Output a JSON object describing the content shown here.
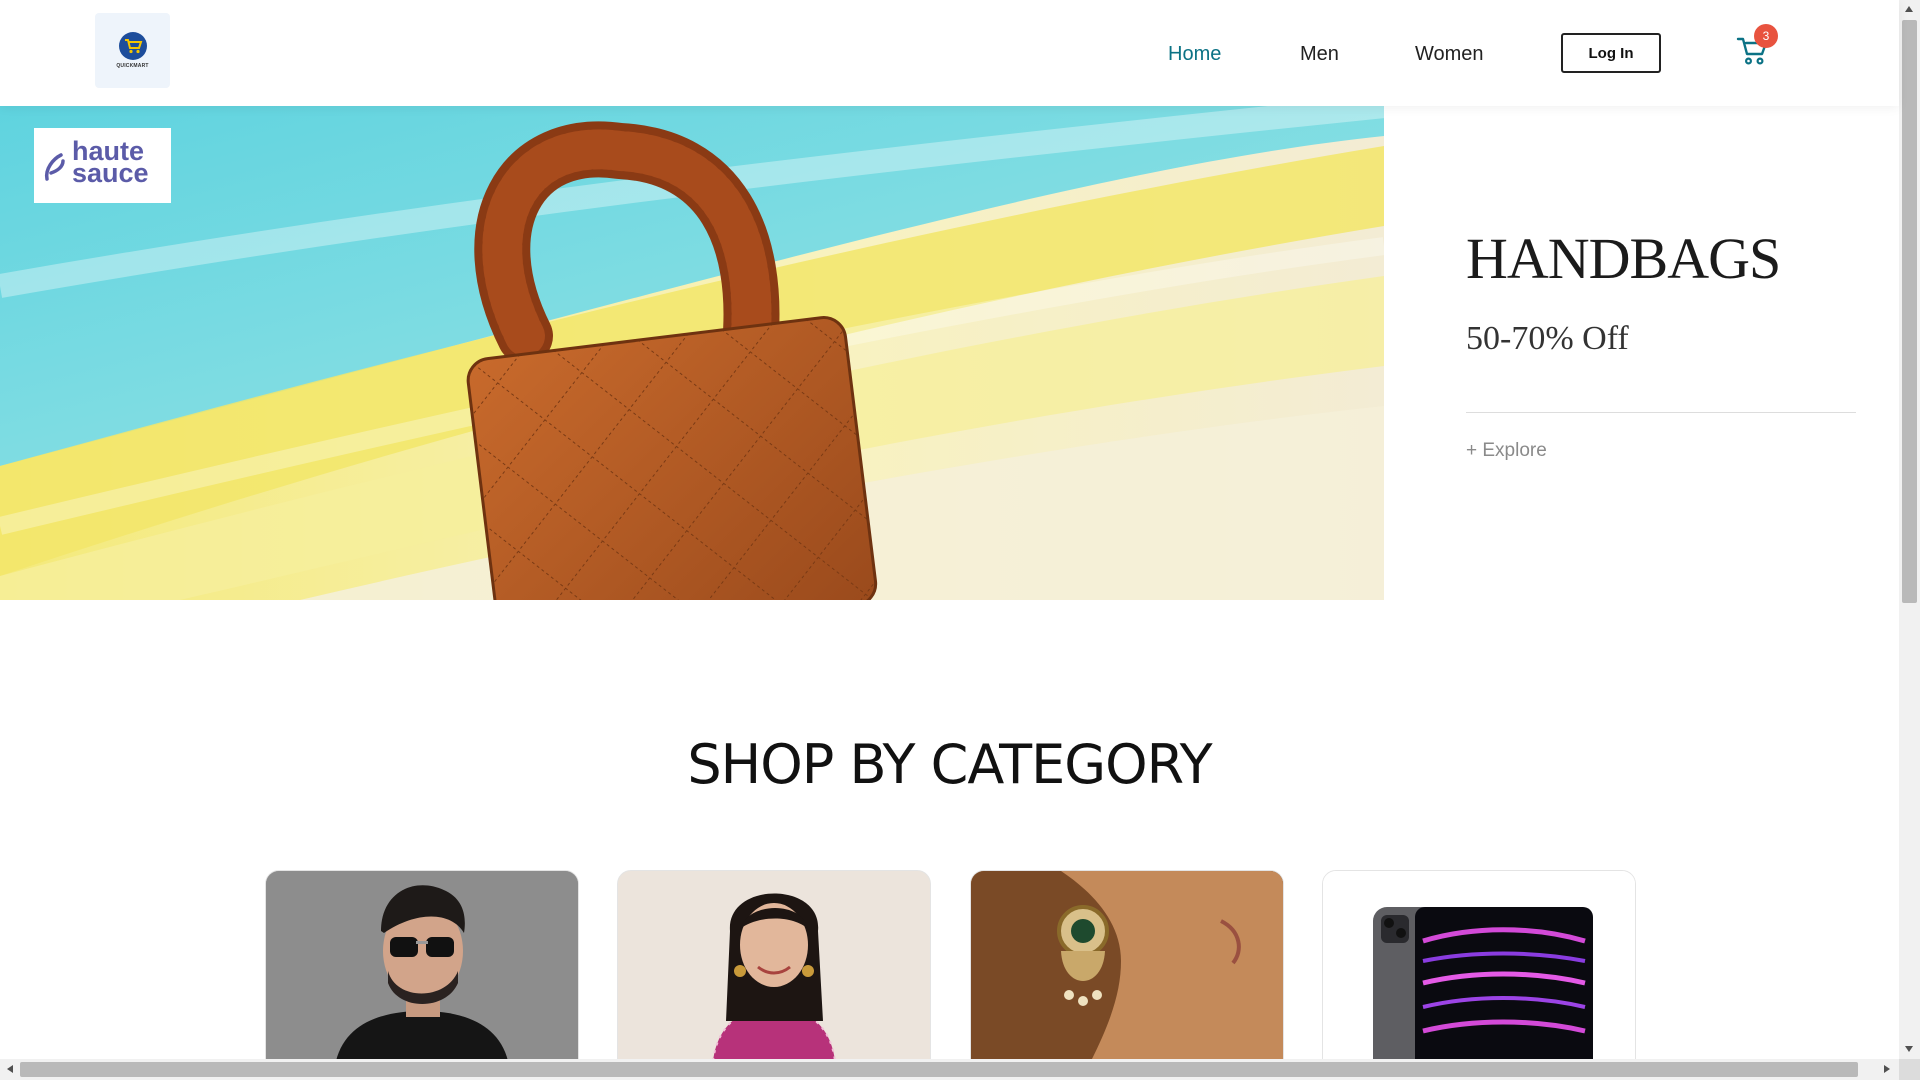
{
  "header": {
    "logo_text": "QUICKMART",
    "nav": [
      {
        "label": "Home",
        "active": true
      },
      {
        "label": "Men",
        "active": false
      },
      {
        "label": "Women",
        "active": false
      }
    ],
    "login_label": "Log In",
    "cart_count": "3",
    "accent_color": "#0b7285",
    "badge_color": "#e8533f"
  },
  "hero": {
    "brand_line1": "haute",
    "brand_line2": "sauce",
    "title": "HANDBAGS",
    "subtitle": "50-70% Off",
    "explore_label": "+ Explore"
  },
  "category": {
    "title": "SHOP BY CATEGORY",
    "cards": [
      {
        "icon": "men-photo"
      },
      {
        "icon": "women-photo"
      },
      {
        "icon": "jewellery-photo"
      },
      {
        "icon": "electronics-photo"
      }
    ]
  }
}
